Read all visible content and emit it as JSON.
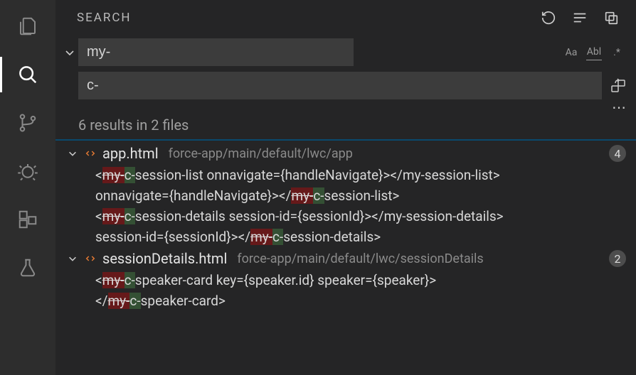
{
  "activity": {
    "items": [
      {
        "name": "explorer"
      },
      {
        "name": "search",
        "active": true
      },
      {
        "name": "source-control"
      },
      {
        "name": "debug"
      },
      {
        "name": "extensions"
      },
      {
        "name": "testing"
      }
    ]
  },
  "header": {
    "title": "SEARCH"
  },
  "search": {
    "value": "my-",
    "case_label": "Aa",
    "whole_word_label": "Abl",
    "regex_label": ".*"
  },
  "replace": {
    "value": "c-"
  },
  "summary": "6 results in 2 files",
  "files": [
    {
      "name": "app.html",
      "path": "force-app/main/default/lwc/app",
      "count": "4",
      "matches": [
        {
          "pre": "<",
          "old": "my-",
          "new": "c-",
          "post": "session-list onnavigate={handleNavigate}></my-session-list>"
        },
        {
          "pre": "onnavigate={handleNavigate}></",
          "old": "my-",
          "new": "c-",
          "post": "session-list>"
        },
        {
          "pre": "<",
          "old": "my-",
          "new": "c-",
          "post": "session-details session-id={sessionId}></my-session-details>"
        },
        {
          "pre": "session-id={sessionId}></",
          "old": "my-",
          "new": "c-",
          "post": "session-details>"
        }
      ]
    },
    {
      "name": "sessionDetails.html",
      "path": "force-app/main/default/lwc/sessionDetails",
      "count": "2",
      "matches": [
        {
          "pre": "<",
          "old": "my-",
          "new": "c-",
          "post": "speaker-card key={speaker.id} speaker={speaker}>"
        },
        {
          "pre": "</",
          "old": "my-",
          "new": "c-",
          "post": "speaker-card>"
        }
      ]
    }
  ]
}
